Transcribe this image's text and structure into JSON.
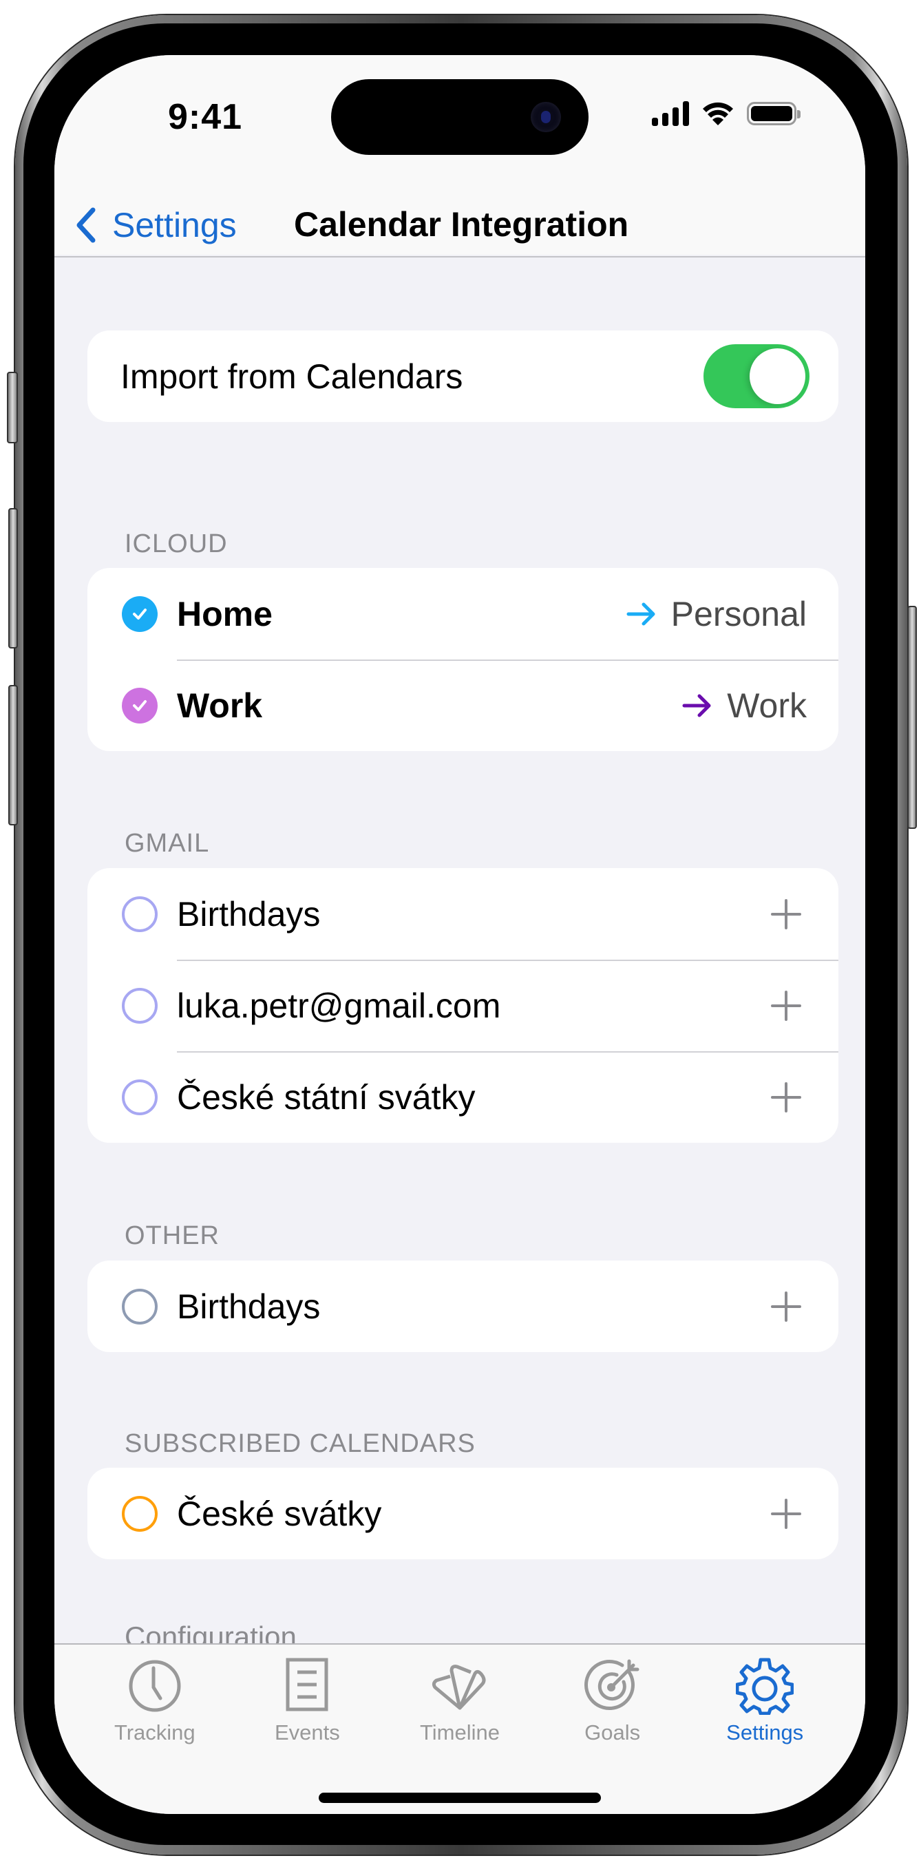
{
  "status_bar": {
    "time": "9:41",
    "signal_icon": "cellular-signal-icon",
    "wifi_icon": "wifi-icon",
    "battery_icon": "battery-icon"
  },
  "nav": {
    "back_label": "Settings",
    "title": "Calendar Integration"
  },
  "import_toggle": {
    "label": "Import from Calendars",
    "on": true,
    "color": "#34c759"
  },
  "sections": [
    {
      "header": "ICLOUD",
      "rows": [
        {
          "label": "Home",
          "checked": true,
          "color": "#1aacf5",
          "target": "Personal",
          "arrow_color": "#1aacf5"
        },
        {
          "label": "Work",
          "checked": true,
          "color": "#cd72e0",
          "target": "Work",
          "arrow_color": "#6a0dad"
        }
      ]
    },
    {
      "header": "GMAIL",
      "rows": [
        {
          "label": "Birthdays",
          "checked": false,
          "color": "#a7a7f2",
          "action": "add"
        },
        {
          "label": "luka.petr@gmail.com",
          "checked": false,
          "color": "#a7a7f2",
          "action": "add"
        },
        {
          "label": "České státní svátky",
          "checked": false,
          "color": "#a7a7f2",
          "action": "add"
        }
      ]
    },
    {
      "header": "OTHER",
      "rows": [
        {
          "label": "Birthdays",
          "checked": false,
          "color": "#8e9bb3",
          "action": "add"
        }
      ]
    },
    {
      "header": "SUBSCRIBED CALENDARS",
      "rows": [
        {
          "label": "České svátky",
          "checked": false,
          "color": "#ff9f0a",
          "action": "add"
        }
      ]
    }
  ],
  "next_section_header": "Configuration",
  "tab_bar": {
    "active_color": "#1a6bd0",
    "inactive_color": "#999999",
    "tabs": [
      {
        "label": "Tracking",
        "icon": "clock-icon",
        "active": false
      },
      {
        "label": "Events",
        "icon": "list-document-icon",
        "active": false
      },
      {
        "label": "Timeline",
        "icon": "fanned-cards-icon",
        "active": false
      },
      {
        "label": "Goals",
        "icon": "target-arrow-icon",
        "active": false
      },
      {
        "label": "Settings",
        "icon": "gear-icon",
        "active": true
      }
    ]
  }
}
